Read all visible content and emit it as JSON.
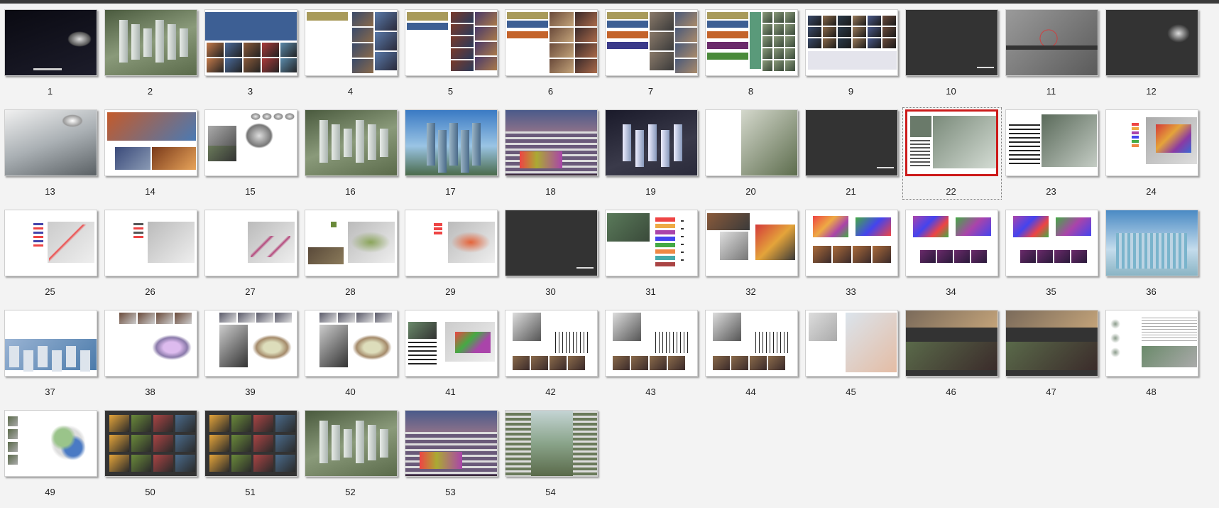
{
  "window": {
    "view": "slide-sorter"
  },
  "selected_slide": "22",
  "slides": [
    {
      "label": "1",
      "kind": "dark-swirl"
    },
    {
      "label": "2",
      "kind": "aerial-towers"
    },
    {
      "label": "3",
      "kind": "blue-header-collage"
    },
    {
      "label": "4",
      "kind": "gold-header-photos"
    },
    {
      "label": "5",
      "kind": "blue-bar-photos"
    },
    {
      "label": "6",
      "kind": "multi-color-bars-photos"
    },
    {
      "label": "7",
      "kind": "color-bars-photos"
    },
    {
      "label": "8",
      "kind": "color-bars-collage"
    },
    {
      "label": "9",
      "kind": "photo-grid"
    },
    {
      "label": "10",
      "kind": "dark-blank"
    },
    {
      "label": "11",
      "kind": "site-map"
    },
    {
      "label": "12",
      "kind": "dark-sketch"
    },
    {
      "label": "13",
      "kind": "water-splash"
    },
    {
      "label": "14",
      "kind": "rock-arch"
    },
    {
      "label": "15",
      "kind": "sketches"
    },
    {
      "label": "16",
      "kind": "aerial-towers"
    },
    {
      "label": "17",
      "kind": "city-skyline"
    },
    {
      "label": "18",
      "kind": "mall-facade"
    },
    {
      "label": "19",
      "kind": "night-aerial"
    },
    {
      "label": "20",
      "kind": "street-render"
    },
    {
      "label": "21",
      "kind": "dark-blank"
    },
    {
      "label": "22",
      "kind": "plan-render"
    },
    {
      "label": "23",
      "kind": "table-render"
    },
    {
      "label": "24",
      "kind": "colored-plan"
    },
    {
      "label": "25",
      "kind": "red-plan"
    },
    {
      "label": "26",
      "kind": "grey-plan"
    },
    {
      "label": "27",
      "kind": "magenta-plan"
    },
    {
      "label": "28",
      "kind": "green-plan"
    },
    {
      "label": "29",
      "kind": "orange-plan"
    },
    {
      "label": "30",
      "kind": "dark-blank"
    },
    {
      "label": "31",
      "kind": "section-diagram"
    },
    {
      "label": "32",
      "kind": "bubble-diagram"
    },
    {
      "label": "33",
      "kind": "colored-blobs"
    },
    {
      "label": "34",
      "kind": "colored-blobs-photos"
    },
    {
      "label": "35",
      "kind": "colored-blobs-photos"
    },
    {
      "label": "36",
      "kind": "glass-building"
    },
    {
      "label": "37",
      "kind": "skyline-wide"
    },
    {
      "label": "38",
      "kind": "oval-plan"
    },
    {
      "label": "39",
      "kind": "oval-plan-photos"
    },
    {
      "label": "40",
      "kind": "oval-plan-photos"
    },
    {
      "label": "41",
      "kind": "table-plan"
    },
    {
      "label": "42",
      "kind": "floor-plans"
    },
    {
      "label": "43",
      "kind": "floor-plans"
    },
    {
      "label": "44",
      "kind": "floor-plans"
    },
    {
      "label": "45",
      "kind": "elevations"
    },
    {
      "label": "46",
      "kind": "dark-photos"
    },
    {
      "label": "47",
      "kind": "dark-photos"
    },
    {
      "label": "48",
      "kind": "text-table"
    },
    {
      "label": "49",
      "kind": "venn-diagram"
    },
    {
      "label": "50",
      "kind": "dark-collage"
    },
    {
      "label": "51",
      "kind": "dark-collage"
    },
    {
      "label": "52",
      "kind": "aerial-towers"
    },
    {
      "label": "53",
      "kind": "mall-facade"
    },
    {
      "label": "54",
      "kind": "atrium"
    }
  ]
}
